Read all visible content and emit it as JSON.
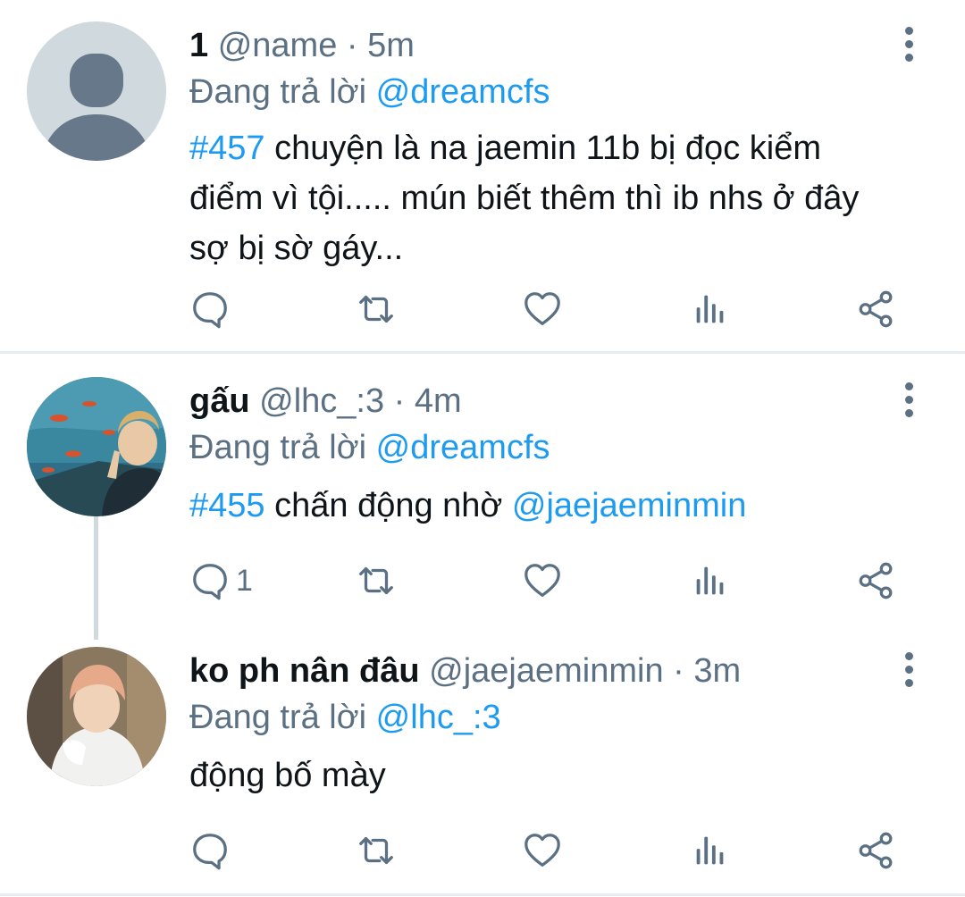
{
  "tweets": [
    {
      "display_name": "1",
      "handle": "@name",
      "time": "5m",
      "reply_prefix": "Đang trả lời",
      "reply_to": "@dreamcfs",
      "hashtag": "#457",
      "text_line1": " chuyện là na jaemin 11b bị đọc kiểm",
      "text_line2": "điểm vì tội..... mún biết thêm thì ib nhs ở đây",
      "text_line3": "sợ bị sờ gáy...",
      "reply_count": ""
    },
    {
      "display_name": "gấu",
      "handle": "@lhc_:3",
      "time": "4m",
      "reply_prefix": "Đang trả lời",
      "reply_to": "@dreamcfs",
      "hashtag": "#455",
      "text": " chấn động nhờ ",
      "mention": "@jaejaeminmin",
      "reply_count": "1"
    },
    {
      "display_name": "ko ph nân đâu",
      "handle": "@jaejaeminmin",
      "time": "3m",
      "reply_prefix": "Đang trả lời",
      "reply_to": "@lhc_:3",
      "text": "động bố mày",
      "reply_count": ""
    }
  ],
  "separator": "·",
  "icons": {
    "reply": "reply-bubble-icon",
    "retweet": "retweet-icon",
    "like": "heart-icon",
    "views": "analytics-bars-icon",
    "share": "share-icon",
    "more": "more-vertical-icon"
  },
  "colors": {
    "link": "#1d9bf0",
    "muted": "#5b7083",
    "text": "#0f1419",
    "divider": "#e6ecf0"
  }
}
